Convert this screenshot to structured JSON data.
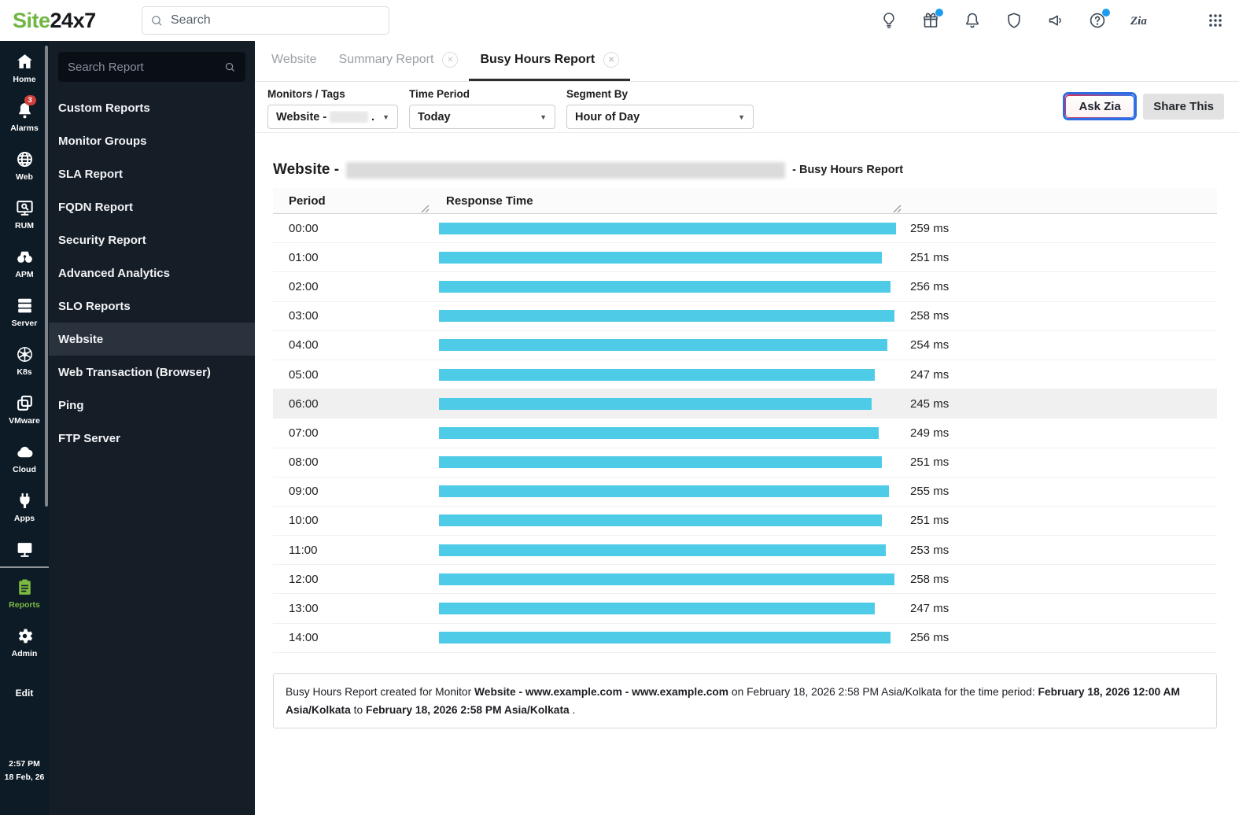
{
  "header": {
    "logo": {
      "part1": "Site",
      "part2": "24x7"
    },
    "search": {
      "placeholder": "Search"
    },
    "icons": [
      {
        "name": "lightbulb-icon"
      },
      {
        "name": "gift-icon",
        "dot": true
      },
      {
        "name": "bell-icon"
      },
      {
        "name": "shield-icon"
      },
      {
        "name": "megaphone-icon"
      },
      {
        "name": "help-icon",
        "dot": true
      },
      {
        "name": "zia-icon"
      },
      {
        "name": "apps-grid-icon"
      }
    ]
  },
  "nav_rail": {
    "items": [
      {
        "label": "Home",
        "icon": "home-icon"
      },
      {
        "label": "Alarms",
        "icon": "alarm-bell-icon",
        "badge": "3"
      },
      {
        "label": "Web",
        "icon": "globe-icon"
      },
      {
        "label": "RUM",
        "icon": "rum-monitor-icon"
      },
      {
        "label": "APM",
        "icon": "binoculars-icon"
      },
      {
        "label": "Server",
        "icon": "server-icon"
      },
      {
        "label": "K8s",
        "icon": "kubernetes-icon"
      },
      {
        "label": "VMware",
        "icon": "vmware-icon"
      },
      {
        "label": "Cloud",
        "icon": "cloud-icon"
      },
      {
        "label": "Apps",
        "icon": "plug-icon"
      },
      {
        "icon": "monitor-icon",
        "partial": true
      },
      {
        "divider": true
      },
      {
        "label": "Reports",
        "icon": "clipboard-icon",
        "active": true
      },
      {
        "label": "Admin",
        "icon": "gear-icon"
      }
    ],
    "edit_label": "Edit",
    "clock": {
      "time": "2:57 PM",
      "date": "18 Feb, 26"
    },
    "accent_green": "#7cb940",
    "badge_red": "#d03f3a"
  },
  "report_sidebar": {
    "search": {
      "placeholder": "Search Report"
    },
    "items": [
      {
        "label": "Custom Reports"
      },
      {
        "label": "Monitor Groups"
      },
      {
        "label": "SLA Report"
      },
      {
        "label": "FQDN Report"
      },
      {
        "label": "Security Report"
      },
      {
        "label": "Advanced Analytics"
      },
      {
        "label": "SLO Reports"
      },
      {
        "label": "Website",
        "active": true
      },
      {
        "label": "Web Transaction (Browser)"
      },
      {
        "label": "Ping"
      },
      {
        "label": "FTP Server"
      }
    ]
  },
  "tabs": [
    {
      "label": "Website"
    },
    {
      "label": "Summary Report",
      "closable": true
    },
    {
      "label": "Busy Hours Report",
      "closable": true,
      "active": true
    }
  ],
  "filters": {
    "monitors": {
      "label": "Monitors / Tags",
      "value_prefix": "Website -",
      "value_suffix": ".",
      "redacted": true
    },
    "time_period": {
      "label": "Time Period",
      "value": "Today"
    },
    "segment_by": {
      "label": "Segment By",
      "value": "Hour of Day"
    }
  },
  "actions": {
    "ask_zia_label": "Ask Zia",
    "share_label": "Share This"
  },
  "report": {
    "title_prefix": "Website -",
    "title_redacted": true,
    "title_suffix": "- Busy Hours Report"
  },
  "chart_data": {
    "type": "bar",
    "title": "Website - Busy Hours Report",
    "columns": [
      "Period",
      "Response Time"
    ],
    "categories": [
      "00:00",
      "01:00",
      "02:00",
      "03:00",
      "04:00",
      "05:00",
      "06:00",
      "07:00",
      "08:00",
      "09:00",
      "10:00",
      "11:00",
      "12:00",
      "13:00",
      "14:00"
    ],
    "values": [
      259,
      251,
      256,
      258,
      254,
      247,
      245,
      249,
      251,
      255,
      251,
      253,
      258,
      247,
      256
    ],
    "unit": "ms",
    "bar_color": "#4ecbe6",
    "highlighted_category": "06:00",
    "xlim": [
      0,
      259
    ],
    "legend": "none",
    "grid": "off"
  },
  "footer_note": {
    "parts": [
      {
        "text": "Busy Hours Report created for Monitor ",
        "bold": false
      },
      {
        "text": "Website - www.example.com - www.example.com",
        "bold": true
      },
      {
        "text": " on February 18, 2026 2:58 PM Asia/Kolkata for the time period: ",
        "bold": false
      },
      {
        "text": "February 18, 2026 12:00 AM Asia/Kolkata",
        "bold": true
      },
      {
        "text": " to ",
        "bold": false
      },
      {
        "text": "February 18, 2026 2:58 PM Asia/Kolkata",
        "bold": true
      },
      {
        "text": " .",
        "bold": false
      }
    ]
  }
}
